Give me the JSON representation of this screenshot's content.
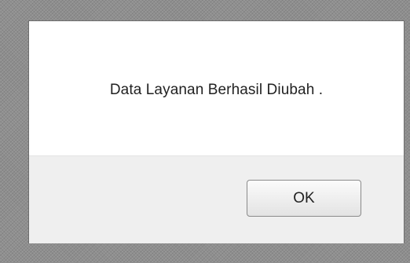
{
  "dialog": {
    "message": "Data Layanan Berhasil Diubah .",
    "ok_label": "OK"
  }
}
